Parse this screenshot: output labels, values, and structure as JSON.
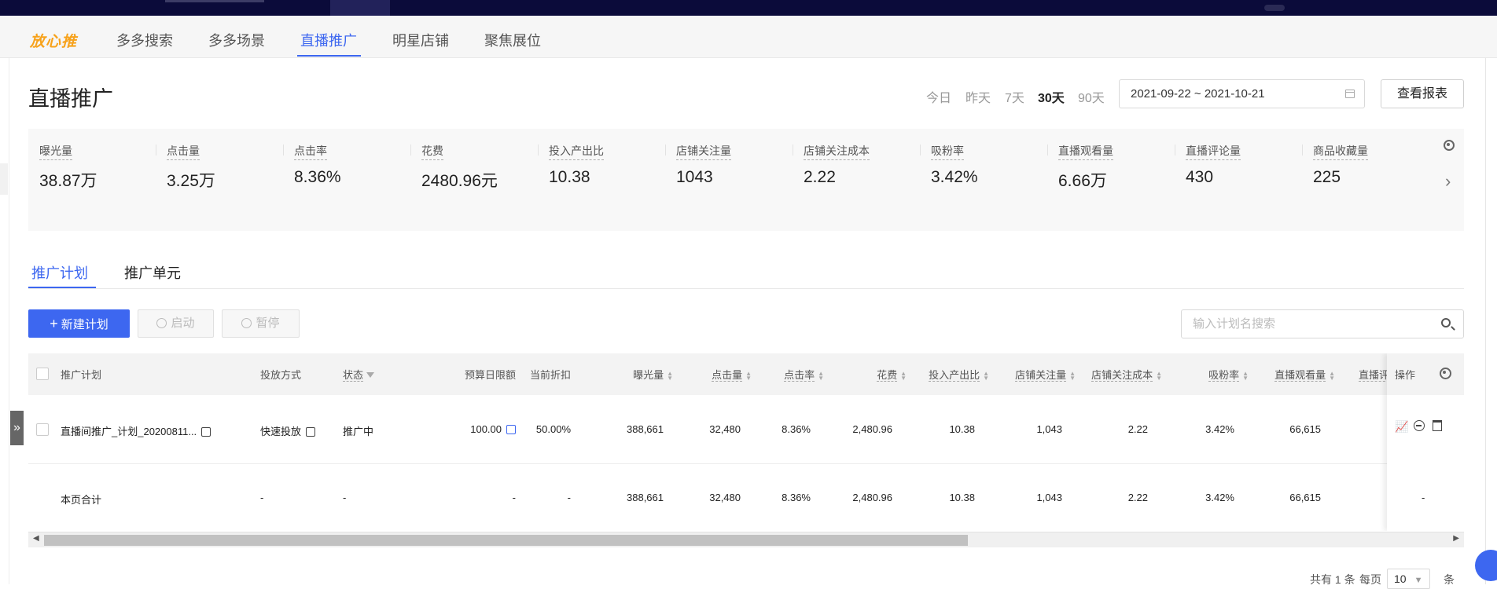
{
  "nav": {
    "logo": "放心推",
    "items": [
      "多多搜索",
      "多多场景",
      "直播推广",
      "明星店铺",
      "聚焦展位"
    ],
    "active_index": 2
  },
  "header": {
    "title": "直播推广",
    "ranges": [
      "今日",
      "昨天",
      "7天",
      "30天",
      "90天"
    ],
    "active_range": "30天",
    "date_range": "2021-09-22 ~ 2021-10-21",
    "report_button": "查看报表"
  },
  "metrics": [
    {
      "label": "曝光量",
      "value": "38.87万"
    },
    {
      "label": "点击量",
      "value": "3.25万"
    },
    {
      "label": "点击率",
      "value": "8.36%"
    },
    {
      "label": "花费",
      "value": "2480.96元"
    },
    {
      "label": "投入产出比",
      "value": "10.38"
    },
    {
      "label": "店铺关注量",
      "value": "1043"
    },
    {
      "label": "店铺关注成本",
      "value": "2.22"
    },
    {
      "label": "吸粉率",
      "value": "3.42%"
    },
    {
      "label": "直播观看量",
      "value": "6.66万"
    },
    {
      "label": "直播评论量",
      "value": "430"
    },
    {
      "label": "商品收藏量",
      "value": "225"
    }
  ],
  "subtabs": [
    "推广计划",
    "推广单元"
  ],
  "toolbar": {
    "new_plan": "新建计划",
    "start": "启动",
    "pause": "暂停",
    "search_placeholder": "输入计划名搜索"
  },
  "table": {
    "headers": {
      "plan": "推广计划",
      "mode": "投放方式",
      "status": "状态",
      "budget": "预算日限额",
      "discount": "当前折扣",
      "impressions": "曝光量",
      "clicks": "点击量",
      "ctr": "点击率",
      "cost": "花费",
      "roi": "投入产出比",
      "follows": "店铺关注量",
      "follow_cost": "店铺关注成本",
      "fan_rate": "吸粉率",
      "live_views": "直播观看量",
      "live_comments": "直播评",
      "ops": "操作"
    },
    "row": {
      "plan": "直播间推广_计划_20200811...",
      "mode": "快速投放",
      "status": "推广中",
      "budget": "100.00",
      "discount": "50.00%",
      "impressions": "388,661",
      "clicks": "32,480",
      "ctr": "8.36%",
      "cost": "2,480.96",
      "roi": "10.38",
      "follows": "1,043",
      "follow_cost": "2.22",
      "fan_rate": "3.42%",
      "live_views": "66,615"
    },
    "total": {
      "label": "本页合计",
      "mode": "-",
      "status": "-",
      "budget": "-",
      "discount": "-",
      "impressions": "388,661",
      "clicks": "32,480",
      "ctr": "8.36%",
      "cost": "2,480.96",
      "roi": "10.38",
      "follows": "1,043",
      "follow_cost": "2.22",
      "fan_rate": "3.42%",
      "live_views": "66,615",
      "ops": "-"
    }
  },
  "pager": {
    "total": "共有 1 条",
    "per_page": "每页",
    "size": "10",
    "unit": "条"
  },
  "colors": {
    "accent": "#3d67f0",
    "topbar": "#0b0b3a",
    "logo": "#f7a21b"
  }
}
